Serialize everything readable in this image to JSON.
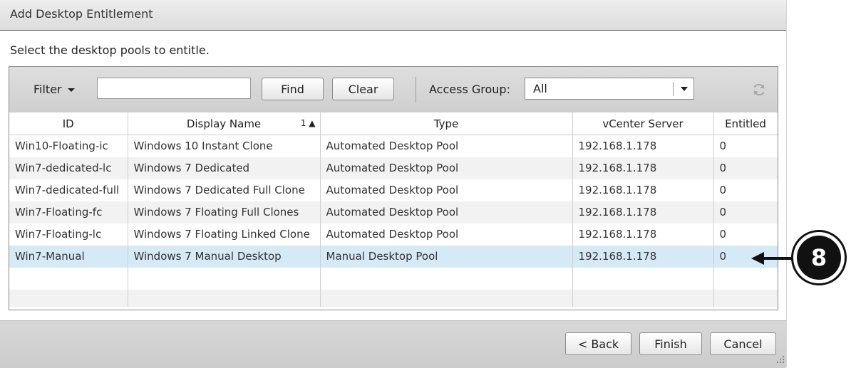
{
  "dialog": {
    "title": "Add Desktop Entitlement",
    "instruction": "Select the desktop pools to entitle."
  },
  "toolbar": {
    "filter_label": "Filter",
    "filter_value": "",
    "find_label": "Find",
    "clear_label": "Clear",
    "access_group_label": "Access Group:",
    "access_group_value": "All"
  },
  "table": {
    "columns": [
      "ID",
      "Display Name",
      "Type",
      "vCenter Server",
      "Entitled"
    ],
    "sort_indicator": "1 ▲",
    "rows": [
      {
        "id": "Win10-Floating-ic",
        "display_name": "Windows 10 Instant Clone",
        "type": "Automated Desktop Pool",
        "vcenter": "192.168.1.178",
        "entitled": "0"
      },
      {
        "id": "Win7-dedicated-lc",
        "display_name": "Windows 7 Dedicated",
        "type": "Automated Desktop Pool",
        "vcenter": "192.168.1.178",
        "entitled": "0"
      },
      {
        "id": "Win7-dedicated-full",
        "display_name": "Windows 7 Dedicated Full Clone",
        "type": "Automated Desktop Pool",
        "vcenter": "192.168.1.178",
        "entitled": "0"
      },
      {
        "id": "Win7-Floating-fc",
        "display_name": "Windows 7 Floating Full Clones",
        "type": "Automated Desktop Pool",
        "vcenter": "192.168.1.178",
        "entitled": "0"
      },
      {
        "id": "Win7-Floating-lc",
        "display_name": "Windows 7 Floating Linked Clone",
        "type": "Automated Desktop Pool",
        "vcenter": "192.168.1.178",
        "entitled": "0"
      },
      {
        "id": "Win7-Manual",
        "display_name": "Windows 7 Manual Desktop",
        "type": "Manual Desktop Pool",
        "vcenter": "192.168.1.178",
        "entitled": "0"
      }
    ],
    "selected_row": 5
  },
  "footer": {
    "back_label": "< Back",
    "finish_label": "Finish",
    "cancel_label": "Cancel"
  },
  "callout": {
    "number": "8"
  },
  "icons": {
    "refresh": "refresh-icon",
    "filter_caret": "chevron-down-icon",
    "select_arrow": "chevron-down-icon",
    "resize_grip": "resize-grip-icon"
  },
  "colors": {
    "selected_row": "#d6e9f7",
    "alt_row": "#f2f2f2",
    "callout": "#111111"
  }
}
